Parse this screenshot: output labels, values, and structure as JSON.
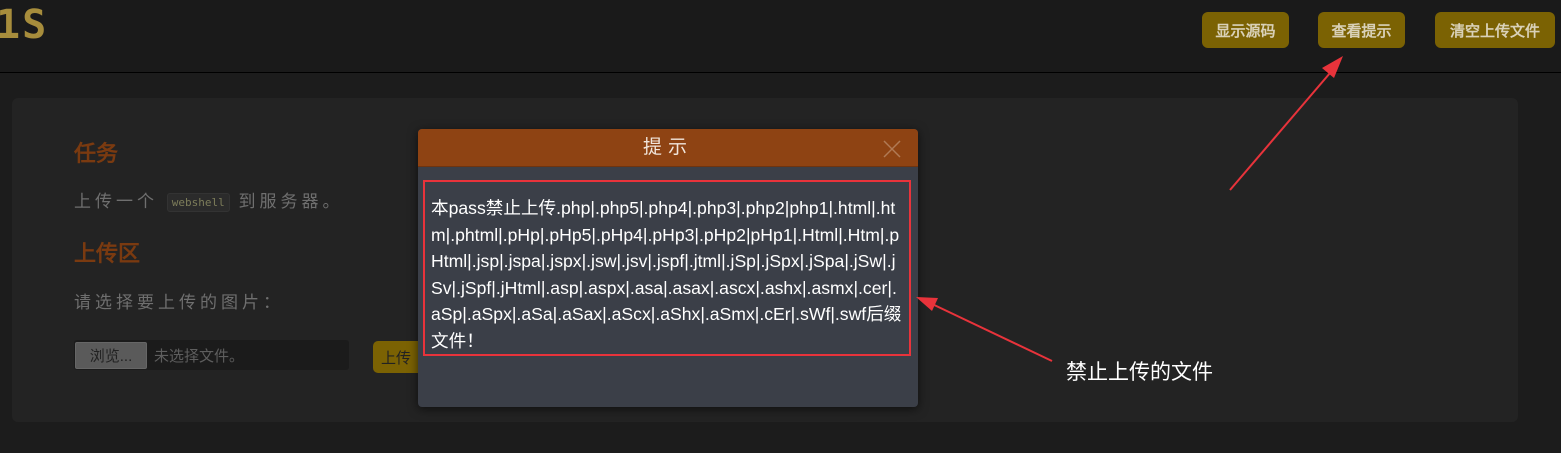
{
  "header": {
    "logo_text": "1S",
    "buttons": [
      {
        "label": "显示源码"
      },
      {
        "label": "查看提示"
      },
      {
        "label": "清空上传文件"
      }
    ]
  },
  "task": {
    "title": "任务",
    "text_before": "上传一个",
    "code": "webshell",
    "text_after": "到服务器。"
  },
  "upload_area": {
    "title": "上传区",
    "prompt": "请选择要上传的图片：",
    "browse_label": "浏览...",
    "file_status": "未选择文件。",
    "upload_label": "上传"
  },
  "dialog": {
    "title": "提示",
    "message": "本pass禁止上传.php|.php5|.php4|.php3|.php2|php1|.html|.htm|.phtml|.pHp|.pHp5|.pHp4|.pHp3|.pHp2|pHp1|.Html|.Htm|.pHtml|.jsp|.jspa|.jspx|.jsw|.jsv|.jspf|.jtml|.jSp|.jSpx|.jSpa|.jSw|.jSv|.jSpf|.jHtml|.asp|.aspx|.asa|.asax|.ascx|.ashx|.asmx|.cer|.aSp|.aSpx|.aSa|.aSax|.aScx|.aShx|.aSmx|.cEr|.sWf|.swf后缀文件！"
  },
  "annotation": {
    "note": "禁止上传的文件",
    "color": "#e8333b"
  },
  "colors": {
    "accent": "#7b6203",
    "dialog_header": "#8e4313",
    "heading": "#7a3a10"
  }
}
